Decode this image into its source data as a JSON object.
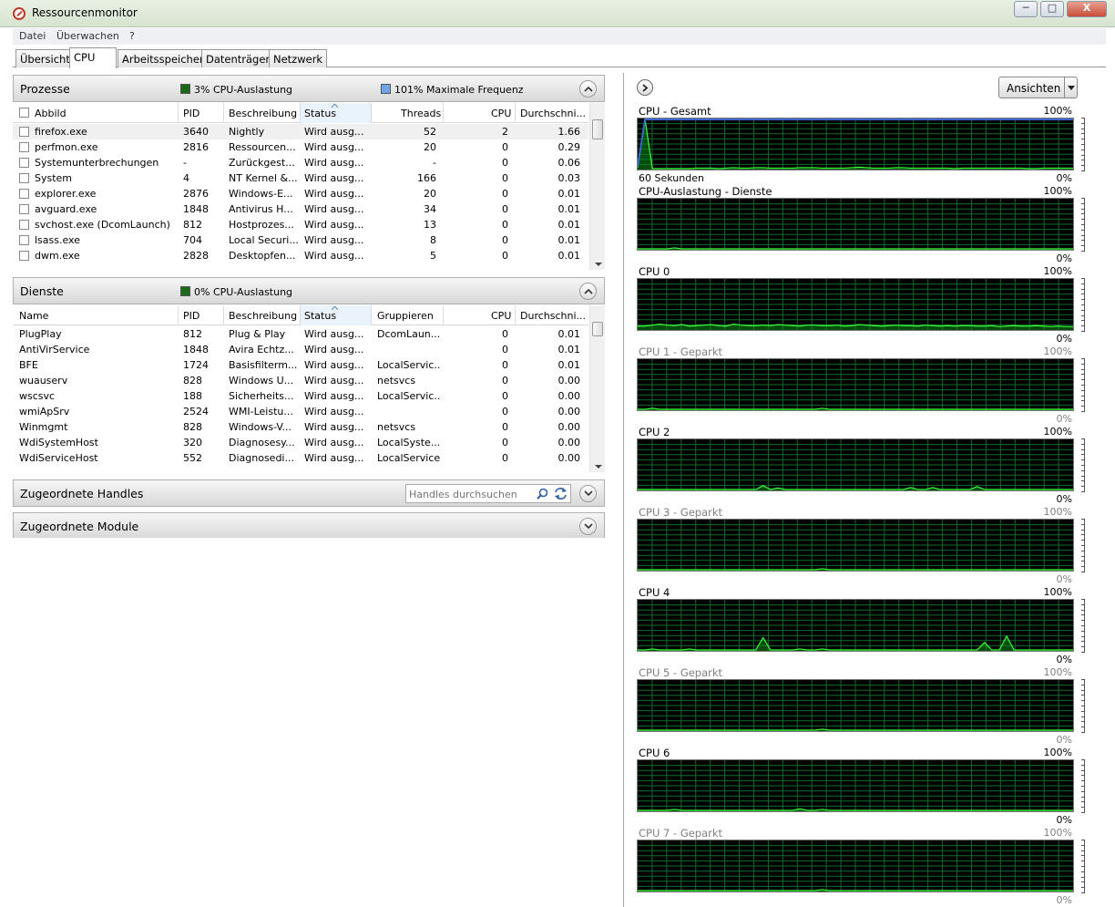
{
  "window": {
    "title": "Ressourcenmonitor",
    "min_label": "─",
    "max_label": "□",
    "close_label": "X"
  },
  "menu": [
    "Datei",
    "Überwachen",
    "?"
  ],
  "tabs": [
    "Übersicht",
    "CPU",
    "Arbeitsspeicher",
    "Datenträger",
    "Netzwerk"
  ],
  "active_tab": "CPU",
  "processes": {
    "title": "Prozesse",
    "cpu_usage_label": "3% CPU-Auslastung",
    "max_freq_label": "101% Maximale Frequenz",
    "usage_color": "#1a6a1a",
    "freq_color": "#6fa6e6",
    "columns": [
      "Abbild",
      "PID",
      "Beschreibung",
      "Status",
      "Threads",
      "CPU",
      "Durchschni..."
    ],
    "rows": [
      [
        "firefox.exe",
        "3640",
        "Nightly",
        "Wird ausg...",
        "52",
        "2",
        "1.66"
      ],
      [
        "perfmon.exe",
        "2816",
        "Ressourcen...",
        "Wird ausg...",
        "20",
        "0",
        "0.29"
      ],
      [
        "Systemunterbrechungen",
        "-",
        "Zurückgest...",
        "Wird ausg...",
        "-",
        "0",
        "0.06"
      ],
      [
        "System",
        "4",
        "NT Kernel &...",
        "Wird ausg...",
        "166",
        "0",
        "0.03"
      ],
      [
        "explorer.exe",
        "2876",
        "Windows-E...",
        "Wird ausg...",
        "20",
        "0",
        "0.01"
      ],
      [
        "avguard.exe",
        "1848",
        "Antivirus H...",
        "Wird ausg...",
        "34",
        "0",
        "0.01"
      ],
      [
        "svchost.exe (DcomLaunch)",
        "812",
        "Hostprozes...",
        "Wird ausg...",
        "13",
        "0",
        "0.01"
      ],
      [
        "lsass.exe",
        "704",
        "Local Securi...",
        "Wird ausg...",
        "8",
        "0",
        "0.01"
      ],
      [
        "dwm.exe",
        "2828",
        "Desktopfen...",
        "Wird ausg...",
        "5",
        "0",
        "0.01"
      ]
    ]
  },
  "services": {
    "title": "Dienste",
    "cpu_usage_label": "0% CPU-Auslastung",
    "columns": [
      "Name",
      "PID",
      "Beschreibung",
      "Status",
      "Gruppieren",
      "CPU",
      "Durchschni..."
    ],
    "rows": [
      [
        "PlugPlay",
        "812",
        "Plug & Play",
        "Wird ausg...",
        "DcomLaun...",
        "0",
        "0.01"
      ],
      [
        "AntiVirService",
        "1848",
        "Avira Echtz...",
        "Wird ausg...",
        "",
        "0",
        "0.01"
      ],
      [
        "BFE",
        "1724",
        "Basisfilterm...",
        "Wird ausg...",
        "LocalServic...",
        "0",
        "0.01"
      ],
      [
        "wuauserv",
        "828",
        "Windows U...",
        "Wird ausg...",
        "netsvcs",
        "0",
        "0.00"
      ],
      [
        "wscsvc",
        "188",
        "Sicherheits...",
        "Wird ausg...",
        "LocalServic...",
        "0",
        "0.00"
      ],
      [
        "wmiApSrv",
        "2524",
        "WMI-Leistu...",
        "Wird ausg...",
        "",
        "0",
        "0.00"
      ],
      [
        "Winmgmt",
        "828",
        "Windows-V...",
        "Wird ausg...",
        "netsvcs",
        "0",
        "0.00"
      ],
      [
        "WdiSystemHost",
        "320",
        "Diagnosesy...",
        "Wird ausg...",
        "LocalSyste...",
        "0",
        "0.00"
      ],
      [
        "WdiServiceHost",
        "552",
        "Diagnosedi...",
        "Wird ausg...",
        "LocalService",
        "0",
        "0.00"
      ]
    ]
  },
  "handles": {
    "title": "Zugeordnete Handles",
    "search_placeholder": "Handles durchsuchen"
  },
  "modules": {
    "title": "Zugeordnete Module"
  },
  "right": {
    "views_label": "Ansichten",
    "graphs": [
      {
        "title": "CPU - Gesamt",
        "max": "100%",
        "min": "0%",
        "xlabel": "60 Sekunden",
        "parked": false,
        "values": [
          2,
          100,
          0,
          0,
          0,
          0,
          0,
          0,
          1,
          1,
          1,
          0,
          1,
          2,
          1,
          1,
          2,
          2,
          1,
          1,
          1,
          1,
          2,
          2,
          2,
          1,
          1,
          1,
          1,
          2,
          3,
          2,
          1,
          1,
          1,
          2,
          2,
          1,
          1,
          1,
          1,
          1,
          1,
          0,
          1,
          1,
          1,
          1,
          1,
          1,
          1,
          1,
          1,
          0,
          0,
          1,
          1,
          1,
          1,
          1
        ]
      },
      {
        "title": "CPU-Auslastung - Dienste",
        "max": "100%",
        "min": "0%",
        "xlabel": "",
        "parked": false,
        "values": [
          0,
          0,
          0,
          0,
          0,
          2,
          0,
          0,
          0,
          0,
          0,
          0,
          0,
          0,
          0,
          0,
          0,
          0,
          0,
          0,
          0,
          0,
          0,
          0,
          0,
          0,
          0,
          0,
          0,
          0,
          0,
          0,
          0,
          0,
          0,
          0,
          0,
          0,
          0,
          0,
          0,
          0,
          0,
          0,
          0,
          0,
          0,
          0,
          0,
          0,
          0,
          0,
          0,
          0,
          0,
          0,
          0,
          0,
          0,
          0
        ]
      },
      {
        "title": "CPU 0",
        "max": "100%",
        "min": "0%",
        "xlabel": "",
        "parked": false,
        "values": [
          6,
          6,
          8,
          10,
          8,
          7,
          9,
          6,
          7,
          8,
          9,
          7,
          6,
          10,
          8,
          7,
          7,
          8,
          7,
          9,
          8,
          7,
          6,
          8,
          8,
          7,
          7,
          8,
          6,
          7,
          9,
          8,
          7,
          6,
          7,
          8,
          7,
          7,
          6,
          8,
          7,
          6,
          7,
          6,
          7,
          7,
          6,
          6,
          7,
          5,
          6,
          7,
          6,
          6,
          7,
          6,
          5,
          6,
          5,
          5
        ]
      },
      {
        "title": "CPU 1 - Geparkt",
        "max": "100%",
        "min": "0%",
        "xlabel": "",
        "parked": true,
        "values": [
          0,
          0,
          2,
          0,
          0,
          0,
          0,
          0,
          0,
          0,
          0,
          0,
          0,
          0,
          0,
          0,
          0,
          0,
          0,
          0,
          0,
          0,
          0,
          0,
          0,
          2,
          0,
          0,
          0,
          0,
          0,
          0,
          0,
          0,
          0,
          0,
          0,
          0,
          0,
          0,
          0,
          0,
          0,
          0,
          0,
          0,
          0,
          0,
          0,
          0,
          0,
          0,
          0,
          0,
          0,
          0,
          0,
          0,
          0,
          0
        ]
      },
      {
        "title": "CPU 2",
        "max": "100%",
        "min": "0%",
        "xlabel": "",
        "parked": false,
        "values": [
          0,
          0,
          0,
          0,
          0,
          0,
          0,
          0,
          0,
          0,
          0,
          0,
          0,
          0,
          0,
          0,
          0,
          8,
          0,
          3,
          0,
          0,
          0,
          0,
          0,
          0,
          0,
          0,
          0,
          0,
          0,
          0,
          0,
          0,
          0,
          0,
          0,
          4,
          0,
          0,
          4,
          0,
          0,
          0,
          0,
          0,
          6,
          0,
          0,
          0,
          0,
          0,
          0,
          0,
          0,
          0,
          0,
          0,
          0,
          0
        ]
      },
      {
        "title": "CPU 3 - Geparkt",
        "max": "100%",
        "min": "0%",
        "xlabel": "",
        "parked": true,
        "values": [
          0,
          0,
          0,
          0,
          0,
          0,
          0,
          0,
          0,
          0,
          0,
          0,
          0,
          0,
          0,
          0,
          0,
          0,
          0,
          0,
          0,
          0,
          0,
          0,
          0,
          2,
          0,
          0,
          0,
          0,
          0,
          0,
          0,
          0,
          0,
          0,
          0,
          0,
          0,
          0,
          0,
          0,
          0,
          0,
          0,
          0,
          0,
          0,
          0,
          0,
          0,
          0,
          0,
          0,
          0,
          0,
          0,
          0,
          0,
          0
        ]
      },
      {
        "title": "CPU 4",
        "max": "100%",
        "min": "0%",
        "xlabel": "",
        "parked": false,
        "values": [
          0,
          0,
          2,
          0,
          0,
          0,
          0,
          2,
          0,
          0,
          0,
          0,
          0,
          0,
          0,
          0,
          0,
          25,
          0,
          0,
          0,
          0,
          2,
          0,
          0,
          2,
          0,
          0,
          0,
          0,
          0,
          0,
          0,
          0,
          0,
          0,
          0,
          0,
          0,
          0,
          0,
          0,
          0,
          0,
          0,
          0,
          0,
          15,
          0,
          0,
          28,
          0,
          0,
          0,
          0,
          0,
          0,
          0,
          0,
          0
        ]
      },
      {
        "title": "CPU 5 - Geparkt",
        "max": "100%",
        "min": "0%",
        "xlabel": "",
        "parked": true,
        "values": [
          0,
          0,
          0,
          0,
          0,
          0,
          0,
          0,
          0,
          0,
          0,
          0,
          0,
          0,
          0,
          0,
          0,
          0,
          0,
          0,
          0,
          0,
          0,
          0,
          0,
          2,
          0,
          0,
          0,
          0,
          0,
          0,
          0,
          0,
          0,
          0,
          0,
          0,
          0,
          0,
          0,
          0,
          0,
          0,
          0,
          0,
          0,
          0,
          0,
          0,
          0,
          0,
          0,
          0,
          0,
          0,
          0,
          0,
          0,
          0
        ]
      },
      {
        "title": "CPU 6",
        "max": "100%",
        "min": "0%",
        "xlabel": "",
        "parked": false,
        "values": [
          0,
          0,
          0,
          0,
          0,
          2,
          0,
          0,
          0,
          0,
          0,
          0,
          0,
          0,
          0,
          0,
          0,
          0,
          0,
          0,
          0,
          0,
          3,
          0,
          0,
          2,
          0,
          0,
          0,
          0,
          0,
          0,
          0,
          0,
          0,
          0,
          0,
          0,
          0,
          0,
          0,
          0,
          0,
          0,
          0,
          0,
          0,
          0,
          0,
          0,
          0,
          0,
          0,
          0,
          0,
          0,
          0,
          0,
          0,
          0
        ]
      },
      {
        "title": "CPU 7 - Geparkt",
        "max": "100%",
        "min": "0%",
        "xlabel": "",
        "parked": true,
        "values": [
          0,
          0,
          0,
          0,
          0,
          0,
          0,
          0,
          0,
          0,
          0,
          0,
          0,
          0,
          0,
          0,
          0,
          0,
          0,
          0,
          0,
          0,
          0,
          0,
          0,
          2,
          0,
          0,
          0,
          0,
          0,
          0,
          0,
          0,
          0,
          0,
          0,
          0,
          0,
          0,
          0,
          0,
          0,
          0,
          0,
          0,
          0,
          0,
          0,
          0,
          0,
          0,
          0,
          0,
          0,
          0,
          0,
          0,
          0,
          0
        ]
      }
    ]
  }
}
